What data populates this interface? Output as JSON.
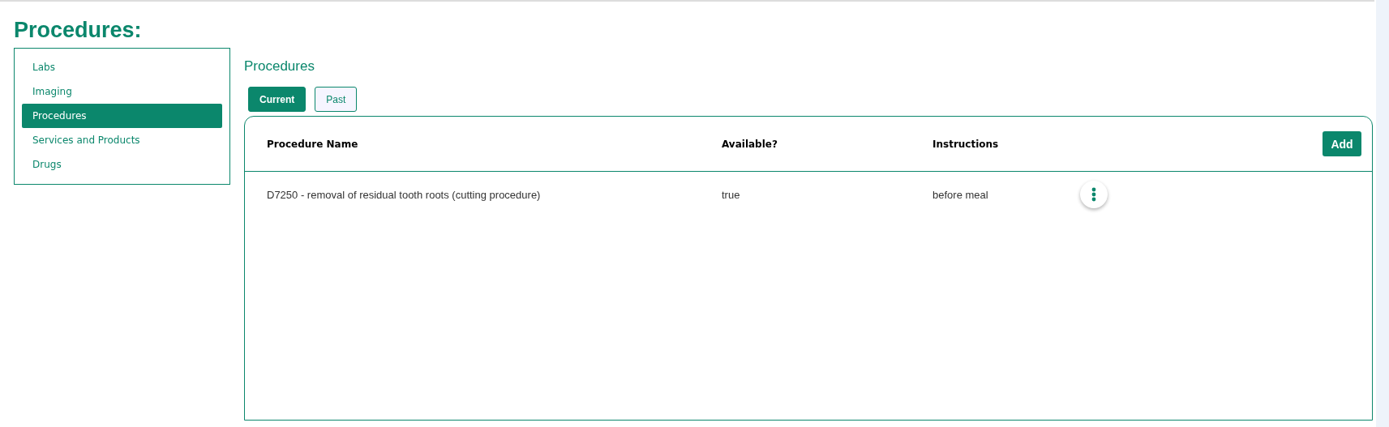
{
  "page_title": "Procedures:",
  "sidebar": {
    "items": [
      {
        "label": "Labs",
        "selected": false
      },
      {
        "label": "Imaging",
        "selected": false
      },
      {
        "label": "Procedures",
        "selected": true
      },
      {
        "label": "Services and Products",
        "selected": false
      },
      {
        "label": "Drugs",
        "selected": false
      }
    ]
  },
  "section_title": "Procedures",
  "tabs": [
    {
      "label": "Current",
      "selected": true
    },
    {
      "label": "Past",
      "selected": false
    }
  ],
  "table": {
    "columns": [
      "Procedure Name",
      "Available?",
      "Instructions"
    ],
    "add_button": "Add",
    "rows": [
      {
        "cells": [
          "D7250 - removal of residual tooth roots (cutting procedure)",
          "true",
          "before meal"
        ]
      }
    ]
  }
}
